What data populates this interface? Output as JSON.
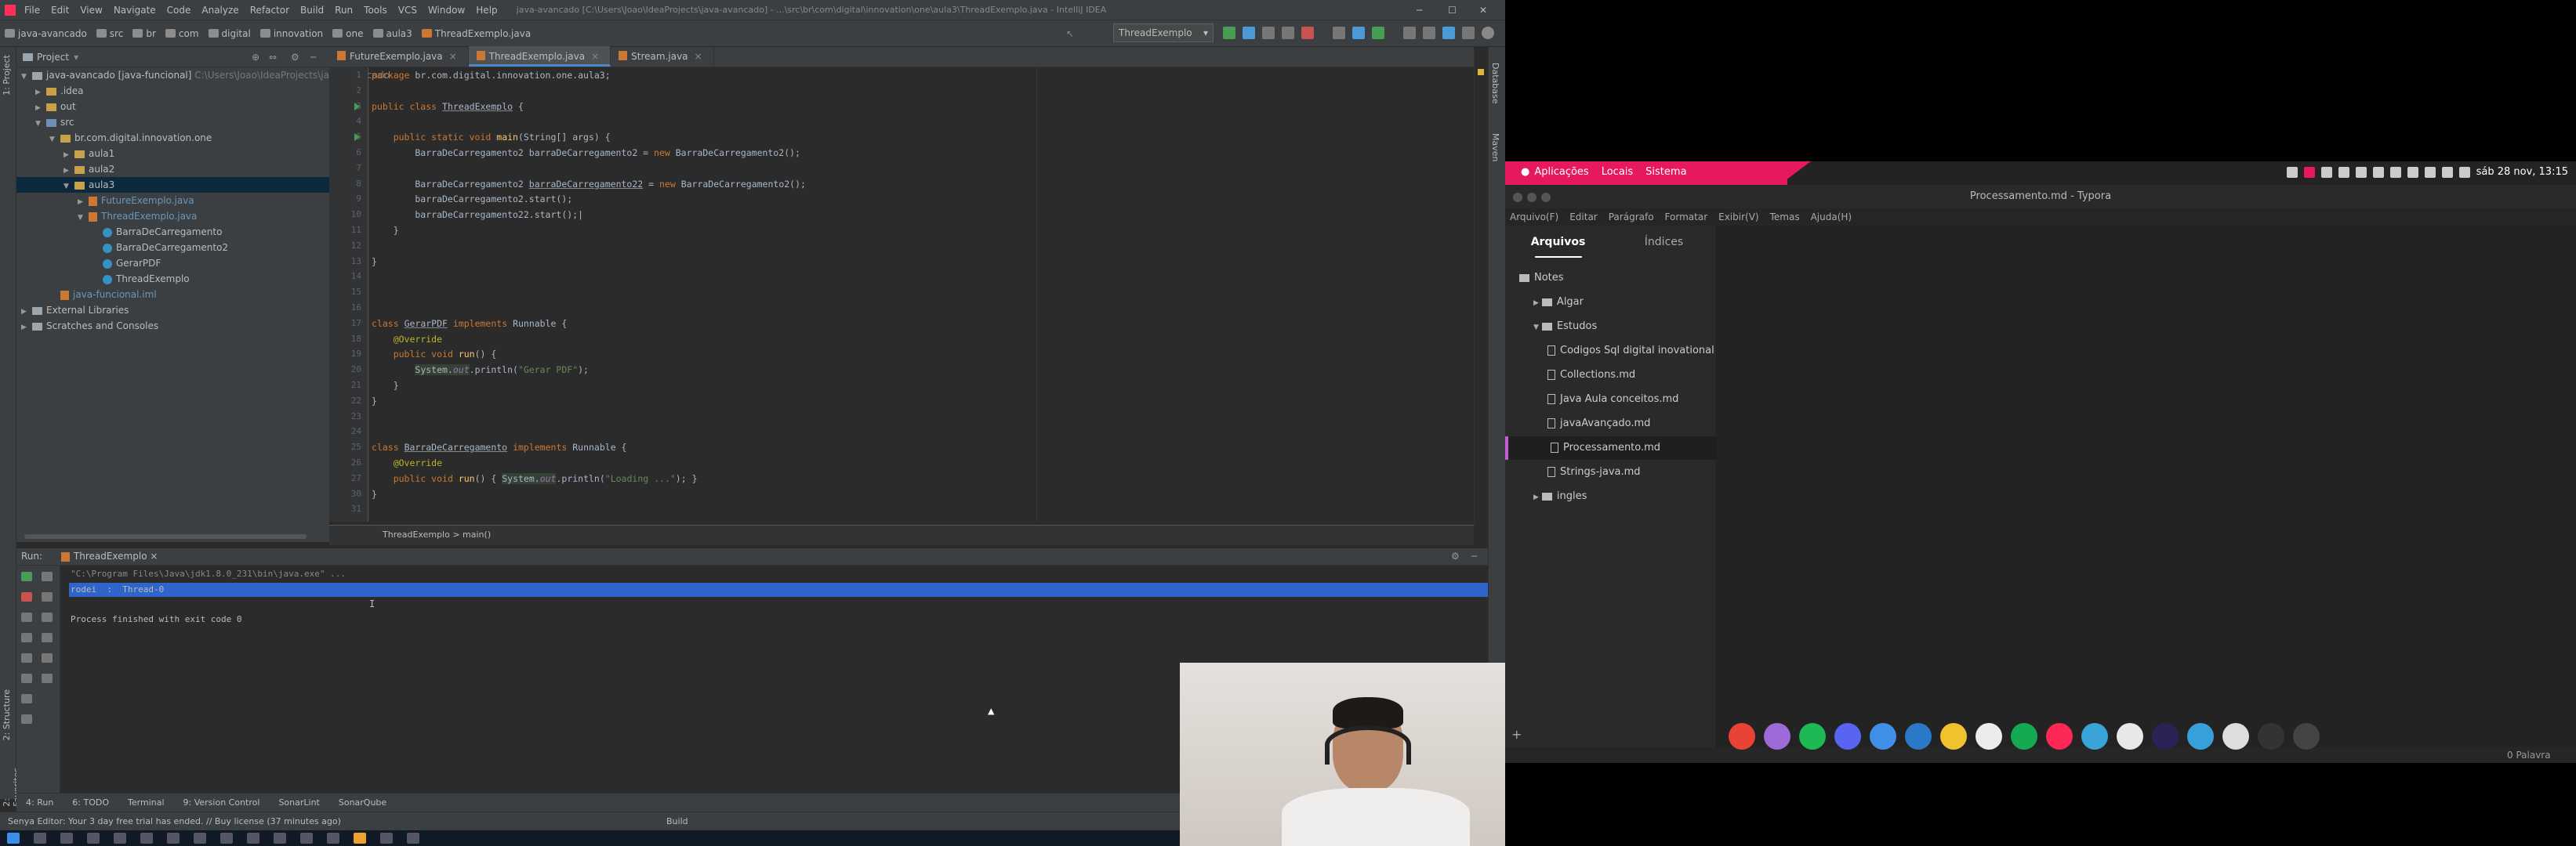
{
  "ide": {
    "menu": [
      "File",
      "Edit",
      "View",
      "Navigate",
      "Code",
      "Analyze",
      "Refactor",
      "Build",
      "Run",
      "Tools",
      "VCS",
      "Window",
      "Help"
    ],
    "window_title": "java-avancado [C:\\Users\\Joao\\IdeaProjects\\java-avancado] - ...\\src\\br\\com\\digital\\innovation\\one\\aula3\\ThreadExemplo.java - IntelliJ IDEA",
    "breadcrumbs": [
      "java-avancado",
      "src",
      "br",
      "com",
      "digital",
      "innovation",
      "one",
      "aula3",
      "ThreadExemplo.java"
    ],
    "run_config": "ThreadExemplo",
    "project_header": "Project",
    "tree": [
      {
        "label": "java-avancado [java-funcional]",
        "suffix": " C:\\Users\\Joao\\IdeaProjects\\java-avancado",
        "indent": 0,
        "kind": "mod",
        "arrow": "▼"
      },
      {
        "label": ".idea",
        "indent": 1,
        "kind": "fold",
        "arrow": "▶"
      },
      {
        "label": "out",
        "indent": 1,
        "kind": "fold",
        "arrow": "▶"
      },
      {
        "label": "src",
        "indent": 1,
        "kind": "src",
        "arrow": "▼"
      },
      {
        "label": "br.com.digital.innovation.one",
        "indent": 2,
        "kind": "fold",
        "arrow": "▼"
      },
      {
        "label": "aula1",
        "indent": 3,
        "kind": "fold",
        "arrow": "▶"
      },
      {
        "label": "aula2",
        "indent": 3,
        "kind": "fold",
        "arrow": "▶"
      },
      {
        "label": "aula3",
        "indent": 3,
        "kind": "fold",
        "arrow": "▼",
        "selected": true
      },
      {
        "label": "FutureExemplo.java",
        "indent": 4,
        "kind": "jfile",
        "arrow": "▶"
      },
      {
        "label": "ThreadExemplo.java",
        "indent": 4,
        "kind": "jfile",
        "arrow": "▼"
      },
      {
        "label": "BarraDeCarregamento",
        "indent": 5,
        "kind": "cls",
        "arrow": ""
      },
      {
        "label": "BarraDeCarregamento2",
        "indent": 5,
        "kind": "cls",
        "arrow": ""
      },
      {
        "label": "GerarPDF",
        "indent": 5,
        "kind": "cls",
        "arrow": ""
      },
      {
        "label": "ThreadExemplo",
        "indent": 5,
        "kind": "cls",
        "arrow": ""
      },
      {
        "label": "java-funcional.iml",
        "indent": 2,
        "kind": "jfile",
        "arrow": ""
      },
      {
        "label": "External Libraries",
        "indent": 0,
        "kind": "mod",
        "arrow": "▶"
      },
      {
        "label": "Scratches and Consoles",
        "indent": 0,
        "kind": "mod",
        "arrow": "▶"
      }
    ],
    "tabs": [
      {
        "label": "FutureExemplo.java",
        "active": false
      },
      {
        "label": "ThreadExemplo.java",
        "active": true
      },
      {
        "label": "Stream.java",
        "active": false
      }
    ],
    "code_lines": [
      {
        "n": "1",
        "html": "<span class=\"kw\">package</span> br.com.digital.innovation.one.aula3;"
      },
      {
        "n": "2",
        "html": ""
      },
      {
        "n": "3",
        "html": "<span class=\"kw\">public class</span> <span class=\"un\">ThreadExemplo</span> {"
      },
      {
        "n": "4",
        "html": ""
      },
      {
        "n": "5",
        "html": "    <span class=\"kw\">public static void</span> <span class=\"fn\">main</span>(String[] args) {"
      },
      {
        "n": "6",
        "html": "        BarraDeCarregamento2 barraDeCarregamento2 = <span class=\"kw\">new</span> BarraDeCarregamento2();"
      },
      {
        "n": "7",
        "html": ""
      },
      {
        "n": "8",
        "html": "        BarraDeCarregamento2 <span class=\"un\">barraDeCarregamento22</span> = <span class=\"kw\">new</span> BarraDeCarregamento2();"
      },
      {
        "n": "9",
        "html": "        barraDeCarregamento2.start();"
      },
      {
        "n": "10",
        "html": "        barraDeCarregamento22.start();|"
      },
      {
        "n": "11",
        "html": "    }"
      },
      {
        "n": "12",
        "html": ""
      },
      {
        "n": "13",
        "html": "}"
      },
      {
        "n": "14",
        "html": ""
      },
      {
        "n": "15",
        "html": ""
      },
      {
        "n": "16",
        "html": ""
      },
      {
        "n": "17",
        "html": "<span class=\"kw\">class</span> <span class=\"un\">GerarPDF</span> <span class=\"kw\">implements</span> Runnable {"
      },
      {
        "n": "18",
        "html": "    <span class=\"ann\">@Override</span>"
      },
      {
        "n": "19",
        "html": "    <span class=\"kw\">public void</span> <span class=\"fn\">run</span>() {"
      },
      {
        "n": "20",
        "html": "        <span class=\"hl\">System.<span class=\"fld\">out</span></span>.println(<span class=\"str\">\"Gerar PDF\"</span>);"
      },
      {
        "n": "21",
        "html": "    }"
      },
      {
        "n": "22",
        "html": "}"
      },
      {
        "n": "23",
        "html": ""
      },
      {
        "n": "24",
        "html": ""
      },
      {
        "n": "25",
        "html": "<span class=\"kw\">class</span> <span class=\"un\">BarraDeCarregamento</span> <span class=\"kw\">implements</span> Runnable {"
      },
      {
        "n": "26",
        "html": "    <span class=\"ann\">@Override</span>"
      },
      {
        "n": "27",
        "html": "    <span class=\"kw\">public void</span> <span class=\"fn\">run</span>() { <span class=\"hl\">System.<span class=\"fld\">out</span></span>.println(<span class=\"str\">\"Loading ...\"</span>); }"
      },
      {
        "n": "30",
        "html": "}"
      },
      {
        "n": "31",
        "html": ""
      }
    ],
    "code_breadcrumb": "ThreadExemplo   >   main()",
    "run_label": "Run:",
    "run_tab": "ThreadExemplo",
    "console": [
      "\"C:\\Program Files\\Java\\jdk1.8.0_231\\bin\\java.exe\" ...",
      "rodei  :  Thread-0",
      "",
      "Process finished with exit code 0"
    ],
    "bottom_tabs": [
      "4: Run",
      "6: TODO",
      "Terminal",
      "9: Version Control",
      "SonarLint",
      "SonarQube"
    ],
    "status": "Senya Editor: Your 3 day free trial has ended. // Buy license (37 minutes ago)",
    "status_build": "Build",
    "side_left": [
      "1: Project",
      "2: Structure",
      "2: Favorites"
    ],
    "side_right": [
      "Database",
      "Maven"
    ]
  },
  "typora": {
    "panel_left": [
      "Aplicações",
      "Locais",
      "Sistema"
    ],
    "clock": "sáb 28 nov, 13:15",
    "title": "Processamento.md - Typora",
    "menu": [
      "Arquivo(F)",
      "Editar",
      "Parágrafo",
      "Formatar",
      "Exibir(V)",
      "Temas",
      "Ajuda(H)"
    ],
    "sidebar_tabs": [
      "Arquivos",
      "Índices"
    ],
    "files": [
      {
        "label": "Notes",
        "type": "folder",
        "indent": 0
      },
      {
        "label": "Algar",
        "type": "folder",
        "indent": 1,
        "arrow": "▶"
      },
      {
        "label": "Estudos",
        "type": "folder",
        "indent": 1,
        "arrow": "▼"
      },
      {
        "label": "Codigos Sql digital inovational one",
        "type": "file",
        "indent": 2
      },
      {
        "label": "Collections.md",
        "type": "file",
        "indent": 2
      },
      {
        "label": "Java Aula conceitos.md",
        "type": "file",
        "indent": 2
      },
      {
        "label": "javaAvançado.md",
        "type": "file",
        "indent": 2
      },
      {
        "label": "Processamento.md",
        "type": "file",
        "indent": 2,
        "selected": true
      },
      {
        "label": "Strings-java.md",
        "type": "file",
        "indent": 2
      },
      {
        "label": "ingles",
        "type": "folder",
        "indent": 1,
        "arrow": "▶"
      }
    ],
    "add_button": "+",
    "word_count": "0 Palavra",
    "dock_icons": [
      {
        "name": "chrome-icon",
        "color": "#e84335"
      },
      {
        "name": "ghost-app-icon",
        "color": "#9d6ad8"
      },
      {
        "name": "spotify-icon",
        "color": "#1db954"
      },
      {
        "name": "discord-icon",
        "color": "#5865f2"
      },
      {
        "name": "finder-icon",
        "color": "#3f8ee8"
      },
      {
        "name": "vscode-icon",
        "color": "#2a78c6"
      },
      {
        "name": "bee-app-icon",
        "color": "#f2c12e"
      },
      {
        "name": "github-icon",
        "color": "#ececec"
      },
      {
        "name": "mongodb-icon",
        "color": "#13aa52"
      },
      {
        "name": "jetbrains-icon",
        "color": "#fe2857"
      },
      {
        "name": "box-app-icon",
        "color": "#3aa3d8"
      },
      {
        "name": "typora-icon",
        "color": "#e8e8e8"
      },
      {
        "name": "eclipse-icon",
        "color": "#2c2255"
      },
      {
        "name": "world-icon",
        "color": "#37a0d8"
      },
      {
        "name": "disk-icon",
        "color": "#dddddd"
      },
      {
        "name": "terminal-icon",
        "color": "#333333"
      },
      {
        "name": "settings-icon",
        "color": "#444444"
      }
    ]
  }
}
